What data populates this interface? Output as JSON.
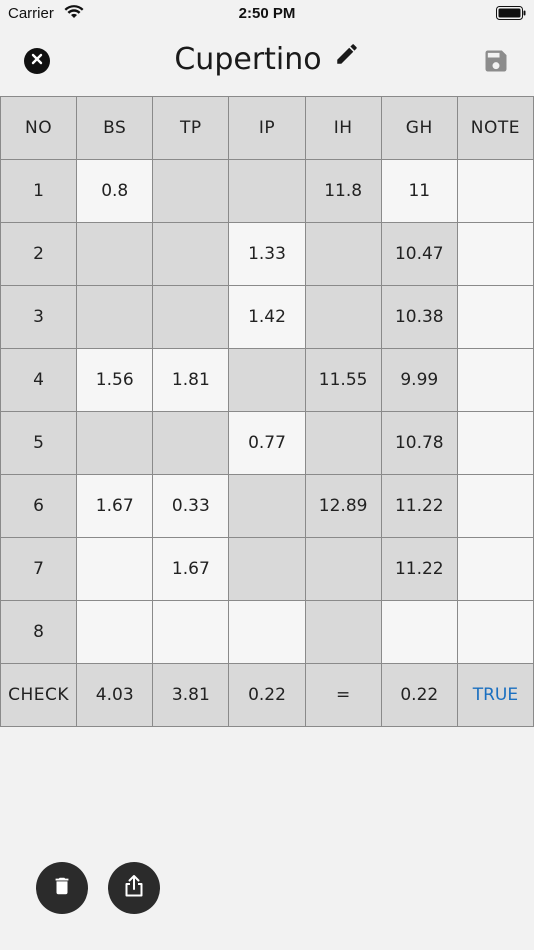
{
  "status": {
    "carrier": "Carrier",
    "time": "2:50 PM"
  },
  "nav": {
    "title": "Cupertino"
  },
  "table": {
    "headers": [
      "NO",
      "BS",
      "TP",
      "IP",
      "IH",
      "GH",
      "NOTE"
    ],
    "rows": [
      [
        "1",
        "0.8",
        "",
        "",
        "11.8",
        "11",
        ""
      ],
      [
        "2",
        "",
        "",
        "1.33",
        "",
        "10.47",
        ""
      ],
      [
        "3",
        "",
        "",
        "1.42",
        "",
        "10.38",
        ""
      ],
      [
        "4",
        "1.56",
        "1.81",
        "",
        "11.55",
        "9.99",
        ""
      ],
      [
        "5",
        "",
        "",
        "0.77",
        "",
        "10.78",
        ""
      ],
      [
        "6",
        "1.67",
        "0.33",
        "",
        "12.89",
        "11.22",
        ""
      ],
      [
        "7",
        "",
        "1.67",
        "",
        "",
        "11.22",
        ""
      ],
      [
        "8",
        "",
        "",
        "",
        "",
        "",
        ""
      ]
    ],
    "check": [
      "CHECK",
      "4.03",
      "3.81",
      "0.22",
      "=",
      "0.22",
      "TRUE"
    ]
  },
  "icons": {
    "close": "close-icon",
    "edit": "pencil-icon",
    "save": "floppy-disk-icon",
    "delete": "trash-icon",
    "share": "share-icon"
  },
  "colors": {
    "accent": "#1a6fc0",
    "gray_cell": "#d9d9d9",
    "white_cell": "#f6f6f6"
  }
}
